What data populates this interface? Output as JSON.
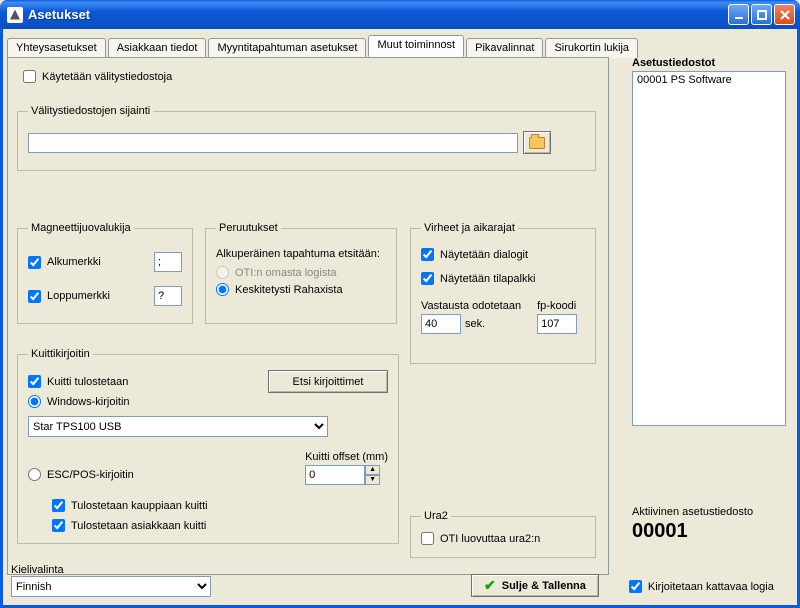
{
  "window": {
    "title": "Asetukset"
  },
  "tabs": {
    "items": [
      {
        "label": "Yhteysasetukset"
      },
      {
        "label": "Asiakkaan tiedot"
      },
      {
        "label": "Myyntitapahtuman asetukset"
      },
      {
        "label": "Muut toiminnost"
      },
      {
        "label": "Pikavalinnat"
      },
      {
        "label": "Sirukortin lukija"
      }
    ],
    "active_index": 3
  },
  "main": {
    "use_temp_files_label": "Käytetään välitystiedostoja",
    "temp_files_group": {
      "legend": "Välitystiedostojen sijainti",
      "path_value": ""
    },
    "mag_reader": {
      "legend": "Magneettijuovalukija",
      "start_label": "Alkumerkki",
      "start_value": ";",
      "end_label": "Loppumerkki",
      "end_value": "?"
    },
    "cancellations": {
      "legend": "Peruutukset",
      "intro": "Alkuperäinen tapahtuma etsitään:",
      "opt_oti": "OTI:n omasta logista",
      "opt_rahaxi": "Keskitetysti Rahaxista"
    },
    "errors": {
      "legend": "Virheet ja aikarajat",
      "show_dialogs": "Näytetään dialogit",
      "show_statusbars": "Näytetään tilapalkki",
      "wait_label": "Vastausta odotetaan",
      "wait_value": "40",
      "wait_unit": "sek.",
      "fp_label": "fp-koodi",
      "fp_value": "107"
    },
    "receipt": {
      "legend": "Kuittikirjoitin",
      "print_receipt": "Kuitti tulostetaan",
      "find_printers_btn": "Etsi kirjoittimet",
      "opt_windows": "Windows-kirjoitin",
      "printer_selected": "Star TPS100 USB",
      "opt_escpos": "ESC/POS-kirjoitin",
      "offset_label": "Kuitti offset (mm)",
      "offset_value": "0",
      "merchant_copy": "Tulostetaan kauppiaan kuitti",
      "customer_copy": "Tulostetaan asiakkaan kuitti"
    },
    "ura2": {
      "legend": "Ura2",
      "option": "OTI luovuttaa ura2:n"
    }
  },
  "side": {
    "heading": "Asetustiedostot",
    "items": [
      "00001 PS Software"
    ],
    "active_label": "Aktiivinen asetustiedosto",
    "active_value": "00001"
  },
  "bottom": {
    "lang_label": "Kielivalinta",
    "lang_value": "Finnish",
    "save_btn": "Sulje & Tallenna",
    "write_log_label": "Kirjoitetaan kattavaa logia"
  }
}
